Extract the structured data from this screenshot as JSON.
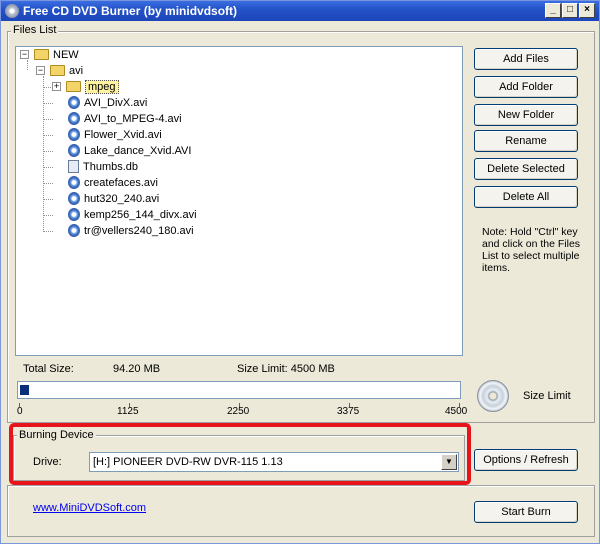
{
  "window": {
    "title": "Free CD DVD Burner (by minidvdsoft)",
    "minimize_label": "_",
    "maximize_label": "□",
    "close_label": "×"
  },
  "files_list": {
    "group_label": "Files List",
    "tree": {
      "root": "NEW",
      "folder": "avi",
      "subfolder": "mpeg",
      "files": [
        "AVI_DivX.avi",
        "AVI_to_MPEG-4.avi",
        "Flower_Xvid.avi",
        "Lake_dance_Xvid.AVI",
        "Thumbs.db",
        "createfaces.avi",
        "hut320_240.avi",
        "kemp256_144_divx.avi",
        "tr@vellers240_180.avi"
      ]
    }
  },
  "buttons": {
    "add_files": "Add Files",
    "add_folder": "Add Folder",
    "new_folder": "New Folder",
    "rename": "Rename",
    "delete_selected": "Delete Selected",
    "delete_all": "Delete All",
    "options_refresh": "Options / Refresh",
    "start_burn": "Start Burn"
  },
  "note": "Note: Hold \"Ctrl\" key and click on the Files List to select multiple items.",
  "size": {
    "total_label": "Total Size:",
    "total_value": "94.20 MB",
    "limit_text": "Size Limit: 4500 MB",
    "progress_fraction": 0.021,
    "ticks": [
      "0",
      "1125",
      "2250",
      "3375",
      "4500"
    ],
    "size_limit_button": "Size Limit"
  },
  "burning": {
    "group_label": "Burning Device",
    "drive_label": "Drive:",
    "drive_value": "[H:] PIONEER DVD-RW  DVR-115 1.13",
    "dropdown_arrow": "▼"
  },
  "footer": {
    "link": "www.MiniDVDSoft.com"
  }
}
